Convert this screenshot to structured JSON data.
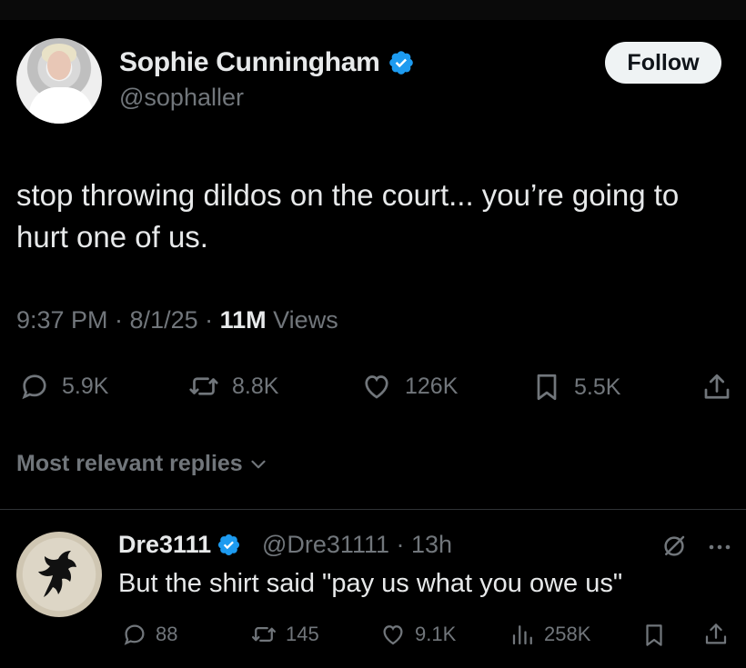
{
  "colors": {
    "background": "#000000",
    "text": "#e7e9ea",
    "muted": "#71767b",
    "verified": "#1d9bf0",
    "divider": "#2f3336"
  },
  "author": {
    "name": "Sophie Cunningham",
    "handle": "@sophaller",
    "verified": true
  },
  "follow_label": "Follow",
  "tweet": {
    "text": "stop throwing dildos on the court... you’re going to hurt one of us.",
    "time": "9:37 PM · 8/1/25 · ",
    "views_count": "11M",
    "views_label": " Views",
    "actions": {
      "replies": "5.9K",
      "reposts": "8.8K",
      "likes": "126K",
      "bookmarks": "5.5K"
    }
  },
  "replies_sort_label": "Most relevant replies",
  "reply": {
    "name": "Dre3111",
    "handle": "@Dre31111 · 13h",
    "verified": true,
    "text": "But the shirt said \"pay us what you owe us\"",
    "actions": {
      "replies": "88",
      "reposts": "145",
      "likes": "9.1K",
      "views": "258K"
    }
  },
  "icons": [
    "verified-badge-icon",
    "reply-icon",
    "repost-icon",
    "like-icon",
    "bookmark-icon",
    "share-icon",
    "chevron-down-icon",
    "grok-icon",
    "more-icon",
    "views-icon"
  ]
}
